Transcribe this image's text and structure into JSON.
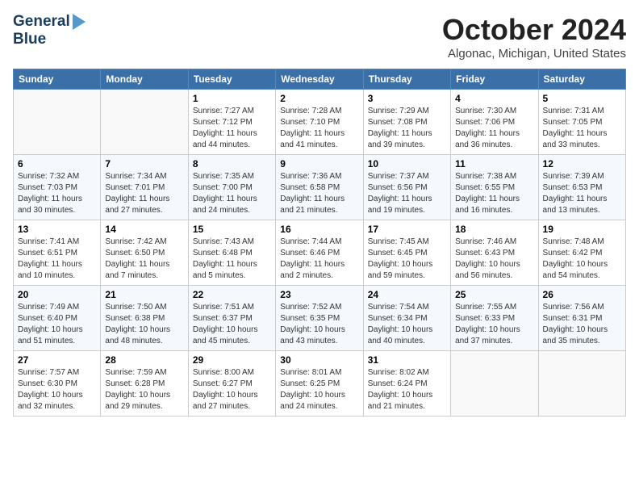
{
  "header": {
    "logo_general": "General",
    "logo_blue": "Blue",
    "month": "October 2024",
    "location": "Algonac, Michigan, United States"
  },
  "weekdays": [
    "Sunday",
    "Monday",
    "Tuesday",
    "Wednesday",
    "Thursday",
    "Friday",
    "Saturday"
  ],
  "weeks": [
    [
      {
        "day": "",
        "detail": ""
      },
      {
        "day": "",
        "detail": ""
      },
      {
        "day": "1",
        "detail": "Sunrise: 7:27 AM\nSunset: 7:12 PM\nDaylight: 11 hours and 44 minutes."
      },
      {
        "day": "2",
        "detail": "Sunrise: 7:28 AM\nSunset: 7:10 PM\nDaylight: 11 hours and 41 minutes."
      },
      {
        "day": "3",
        "detail": "Sunrise: 7:29 AM\nSunset: 7:08 PM\nDaylight: 11 hours and 39 minutes."
      },
      {
        "day": "4",
        "detail": "Sunrise: 7:30 AM\nSunset: 7:06 PM\nDaylight: 11 hours and 36 minutes."
      },
      {
        "day": "5",
        "detail": "Sunrise: 7:31 AM\nSunset: 7:05 PM\nDaylight: 11 hours and 33 minutes."
      }
    ],
    [
      {
        "day": "6",
        "detail": "Sunrise: 7:32 AM\nSunset: 7:03 PM\nDaylight: 11 hours and 30 minutes."
      },
      {
        "day": "7",
        "detail": "Sunrise: 7:34 AM\nSunset: 7:01 PM\nDaylight: 11 hours and 27 minutes."
      },
      {
        "day": "8",
        "detail": "Sunrise: 7:35 AM\nSunset: 7:00 PM\nDaylight: 11 hours and 24 minutes."
      },
      {
        "day": "9",
        "detail": "Sunrise: 7:36 AM\nSunset: 6:58 PM\nDaylight: 11 hours and 21 minutes."
      },
      {
        "day": "10",
        "detail": "Sunrise: 7:37 AM\nSunset: 6:56 PM\nDaylight: 11 hours and 19 minutes."
      },
      {
        "day": "11",
        "detail": "Sunrise: 7:38 AM\nSunset: 6:55 PM\nDaylight: 11 hours and 16 minutes."
      },
      {
        "day": "12",
        "detail": "Sunrise: 7:39 AM\nSunset: 6:53 PM\nDaylight: 11 hours and 13 minutes."
      }
    ],
    [
      {
        "day": "13",
        "detail": "Sunrise: 7:41 AM\nSunset: 6:51 PM\nDaylight: 11 hours and 10 minutes."
      },
      {
        "day": "14",
        "detail": "Sunrise: 7:42 AM\nSunset: 6:50 PM\nDaylight: 11 hours and 7 minutes."
      },
      {
        "day": "15",
        "detail": "Sunrise: 7:43 AM\nSunset: 6:48 PM\nDaylight: 11 hours and 5 minutes."
      },
      {
        "day": "16",
        "detail": "Sunrise: 7:44 AM\nSunset: 6:46 PM\nDaylight: 11 hours and 2 minutes."
      },
      {
        "day": "17",
        "detail": "Sunrise: 7:45 AM\nSunset: 6:45 PM\nDaylight: 10 hours and 59 minutes."
      },
      {
        "day": "18",
        "detail": "Sunrise: 7:46 AM\nSunset: 6:43 PM\nDaylight: 10 hours and 56 minutes."
      },
      {
        "day": "19",
        "detail": "Sunrise: 7:48 AM\nSunset: 6:42 PM\nDaylight: 10 hours and 54 minutes."
      }
    ],
    [
      {
        "day": "20",
        "detail": "Sunrise: 7:49 AM\nSunset: 6:40 PM\nDaylight: 10 hours and 51 minutes."
      },
      {
        "day": "21",
        "detail": "Sunrise: 7:50 AM\nSunset: 6:38 PM\nDaylight: 10 hours and 48 minutes."
      },
      {
        "day": "22",
        "detail": "Sunrise: 7:51 AM\nSunset: 6:37 PM\nDaylight: 10 hours and 45 minutes."
      },
      {
        "day": "23",
        "detail": "Sunrise: 7:52 AM\nSunset: 6:35 PM\nDaylight: 10 hours and 43 minutes."
      },
      {
        "day": "24",
        "detail": "Sunrise: 7:54 AM\nSunset: 6:34 PM\nDaylight: 10 hours and 40 minutes."
      },
      {
        "day": "25",
        "detail": "Sunrise: 7:55 AM\nSunset: 6:33 PM\nDaylight: 10 hours and 37 minutes."
      },
      {
        "day": "26",
        "detail": "Sunrise: 7:56 AM\nSunset: 6:31 PM\nDaylight: 10 hours and 35 minutes."
      }
    ],
    [
      {
        "day": "27",
        "detail": "Sunrise: 7:57 AM\nSunset: 6:30 PM\nDaylight: 10 hours and 32 minutes."
      },
      {
        "day": "28",
        "detail": "Sunrise: 7:59 AM\nSunset: 6:28 PM\nDaylight: 10 hours and 29 minutes."
      },
      {
        "day": "29",
        "detail": "Sunrise: 8:00 AM\nSunset: 6:27 PM\nDaylight: 10 hours and 27 minutes."
      },
      {
        "day": "30",
        "detail": "Sunrise: 8:01 AM\nSunset: 6:25 PM\nDaylight: 10 hours and 24 minutes."
      },
      {
        "day": "31",
        "detail": "Sunrise: 8:02 AM\nSunset: 6:24 PM\nDaylight: 10 hours and 21 minutes."
      },
      {
        "day": "",
        "detail": ""
      },
      {
        "day": "",
        "detail": ""
      }
    ]
  ]
}
